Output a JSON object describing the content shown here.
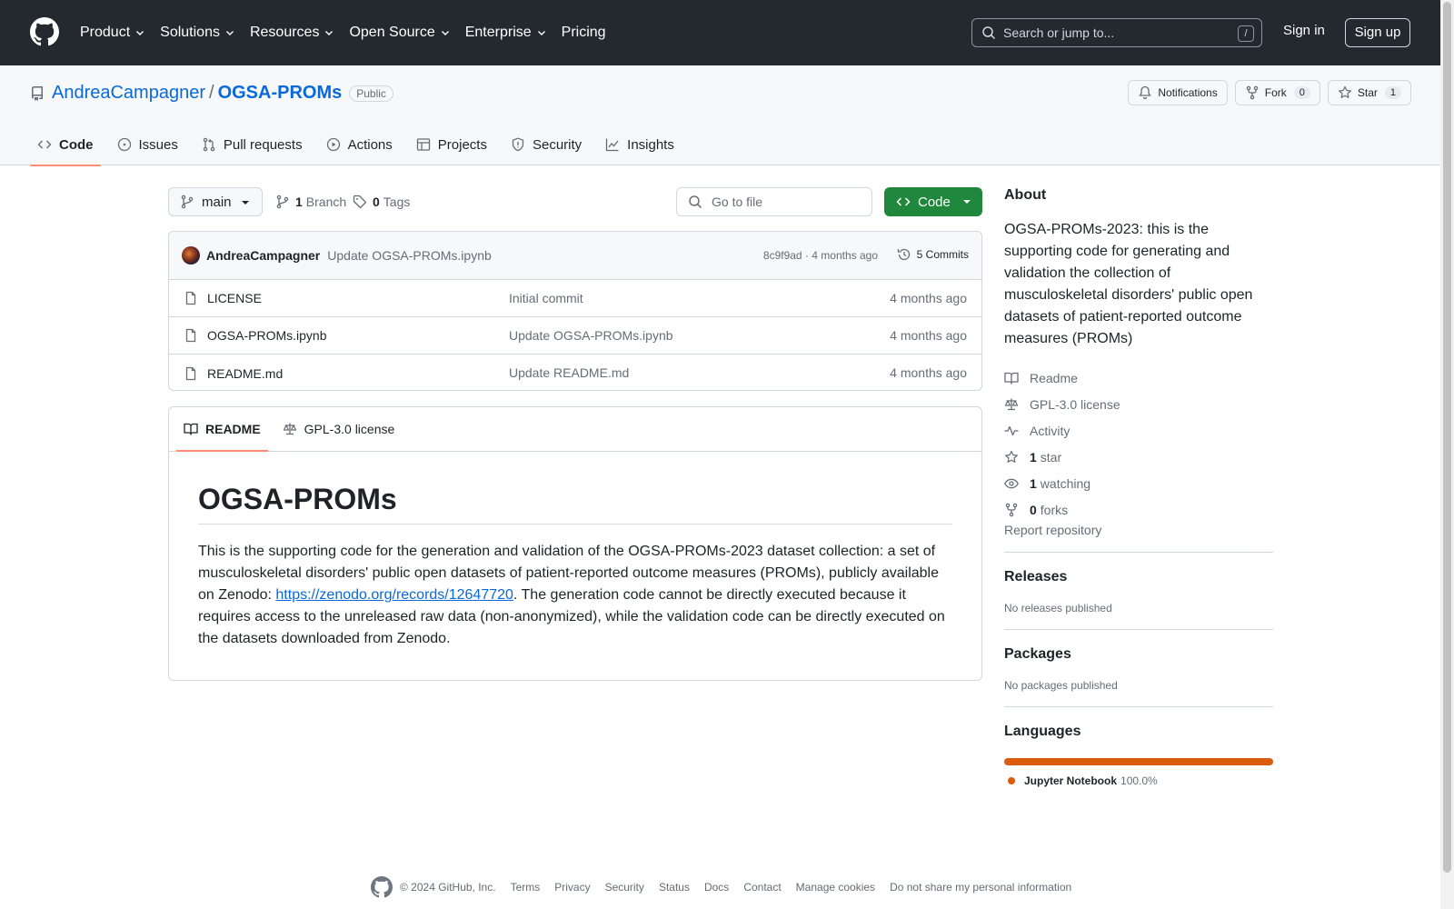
{
  "topnav": {
    "items": [
      {
        "label": "Product"
      },
      {
        "label": "Solutions"
      },
      {
        "label": "Resources"
      },
      {
        "label": "Open Source"
      },
      {
        "label": "Enterprise"
      },
      {
        "label": "Pricing"
      }
    ],
    "search_placeholder": "Search or jump to...",
    "search_shortcut": "/",
    "sign_in": "Sign in",
    "sign_up": "Sign up"
  },
  "repo": {
    "owner": "AndreaCampagner",
    "separator": "/",
    "name": "OGSA-PROMs",
    "visibility": "Public",
    "notifications_label": "Notifications",
    "fork_label": "Fork",
    "fork_count": "0",
    "star_label": "Star",
    "star_count": "1"
  },
  "tabs": [
    {
      "label": "Code",
      "icon": "code-icon"
    },
    {
      "label": "Issues",
      "icon": "issue-icon"
    },
    {
      "label": "Pull requests",
      "icon": "pull-request-icon"
    },
    {
      "label": "Actions",
      "icon": "play-icon"
    },
    {
      "label": "Projects",
      "icon": "table-icon"
    },
    {
      "label": "Security",
      "icon": "shield-icon"
    },
    {
      "label": "Insights",
      "icon": "graph-icon"
    }
  ],
  "toolbar": {
    "branch": "main",
    "branch_count": "1",
    "branch_label": "Branch",
    "tag_count": "0",
    "tag_label": "Tags",
    "goto_placeholder": "Go to file",
    "code_button": "Code"
  },
  "latest_commit": {
    "author": "AndreaCampagner",
    "message": "Update OGSA-PROMs.ipynb",
    "meta": "8c9f9ad · 4 months ago",
    "commits": "5 Commits"
  },
  "files": [
    {
      "name": "LICENSE",
      "commit": "Initial commit",
      "time": "4 months ago"
    },
    {
      "name": "OGSA-PROMs.ipynb",
      "commit": "Update OGSA-PROMs.ipynb",
      "time": "4 months ago"
    },
    {
      "name": "README.md",
      "commit": "Update README.md",
      "time": "4 months ago"
    }
  ],
  "readme": {
    "tab_readme": "README",
    "tab_license": "GPL-3.0 license",
    "title": "OGSA-PROMs",
    "text_before": "This is the supporting code for the generation and validation of the OGSA-PROMs-2023 dataset collection: a set of musculoskeletal disorders' public open datasets of patient-reported outcome measures (PROMs), publicly available on Zenodo: ",
    "link": "https://zenodo.org/records/12647720",
    "text_after": ". The generation code cannot be directly executed because it requires access to the unreleased raw data (non-anonymized), while the validation code can be directly executed on the datasets downloaded from Zenodo."
  },
  "about": {
    "heading": "About",
    "description": "OGSA-PROMs-2023: this is the supporting code for generating and validation the collection of musculoskeletal disorders' public open datasets of patient-reported outcome measures (PROMs)",
    "readme": "Readme",
    "license": "GPL-3.0 license",
    "activity": "Activity",
    "stars_count": "1",
    "stars_label": "star",
    "watching_count": "1",
    "watching_label": "watching",
    "forks_count": "0",
    "forks_label": "forks",
    "report": "Report repository"
  },
  "releases": {
    "heading": "Releases",
    "text": "No releases published"
  },
  "packages": {
    "heading": "Packages",
    "text": "No packages published"
  },
  "languages": {
    "heading": "Languages",
    "items": [
      {
        "name": "Jupyter Notebook",
        "percent": "100.0%",
        "fraction": 1.0,
        "color": "#DA5B0B"
      }
    ]
  },
  "footer": {
    "copyright": "© 2024 GitHub, Inc.",
    "links": [
      "Terms",
      "Privacy",
      "Security",
      "Status",
      "Docs",
      "Contact",
      "Manage cookies",
      "Do not share my personal information"
    ]
  },
  "colors": {
    "header_bg": "#24292f",
    "link": "#0969da",
    "primary_button": "#1f883d",
    "tab_underline": "#fd8c73",
    "jupyter": "#DA5B0B"
  }
}
